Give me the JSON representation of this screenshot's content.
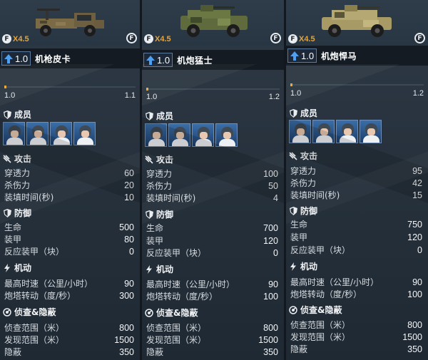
{
  "vehicles": [
    {
      "multiplier": "X4.5",
      "level": "1.0",
      "name": "机枪皮卡",
      "progress": {
        "min": "1.0",
        "max": "1.1",
        "fraction": 0.0
      },
      "crew_title": "成员",
      "attack_title": "攻击",
      "attack": [
        {
          "label": "穿透力",
          "value": "60"
        },
        {
          "label": "杀伤力",
          "value": "20"
        },
        {
          "label": "装填时间(秒)",
          "value": "10"
        }
      ],
      "defense_title": "防御",
      "defense": [
        {
          "label": "生命",
          "value": "500"
        },
        {
          "label": "装甲",
          "value": "80"
        },
        {
          "label": "反应装甲（块）",
          "value": "0"
        }
      ],
      "mobility_title": "机动",
      "mobility": [
        {
          "label": "最高时速（公里/小时）",
          "value": "90"
        },
        {
          "label": "炮塔转动（度/秒）",
          "value": "300"
        }
      ],
      "recon_title": "侦查&隐蔽",
      "recon": [
        {
          "label": "侦查范围（米）",
          "value": "800"
        },
        {
          "label": "发现范围（米）",
          "value": "1500"
        },
        {
          "label": "隐蔽",
          "value": "350"
        }
      ]
    },
    {
      "multiplier": "X4.5",
      "level": "1.0",
      "name": "机炮猛士",
      "progress": {
        "min": "1.0",
        "max": "1.2",
        "fraction": 0.0
      },
      "crew_title": "成员",
      "attack_title": "攻击",
      "attack": [
        {
          "label": "穿透力",
          "value": "100"
        },
        {
          "label": "杀伤力",
          "value": "50"
        },
        {
          "label": "装填时间(秒)",
          "value": "4"
        }
      ],
      "defense_title": "防御",
      "defense": [
        {
          "label": "生命",
          "value": "700"
        },
        {
          "label": "装甲",
          "value": "120"
        },
        {
          "label": "反应装甲（块）",
          "value": "0"
        }
      ],
      "mobility_title": "机动",
      "mobility": [
        {
          "label": "最高时速（公里/小时）",
          "value": "90"
        },
        {
          "label": "炮塔转动（度/秒）",
          "value": "100"
        }
      ],
      "recon_title": "侦查&隐蔽",
      "recon": [
        {
          "label": "侦查范围（米）",
          "value": "800"
        },
        {
          "label": "发现范围（米）",
          "value": "1500"
        },
        {
          "label": "隐蔽",
          "value": "350"
        }
      ]
    },
    {
      "multiplier": "X4.5",
      "level": "1.0",
      "name": "机炮悍马",
      "progress": {
        "min": "1.0",
        "max": "1.2",
        "fraction": 0.0
      },
      "crew_title": "成员",
      "attack_title": "攻击",
      "attack": [
        {
          "label": "穿透力",
          "value": "95"
        },
        {
          "label": "杀伤力",
          "value": "42"
        },
        {
          "label": "装填时间(秒)",
          "value": "15"
        }
      ],
      "defense_title": "防御",
      "defense": [
        {
          "label": "生命",
          "value": "750"
        },
        {
          "label": "装甲",
          "value": "120"
        },
        {
          "label": "反应装甲（块）",
          "value": "0"
        }
      ],
      "mobility_title": "机动",
      "mobility": [
        {
          "label": "最高时速（公里/小时）",
          "value": "90"
        },
        {
          "label": "炮塔转动（度/秒）",
          "value": "100"
        }
      ],
      "recon_title": "侦查&隐蔽",
      "recon": [
        {
          "label": "侦查范围（米）",
          "value": "800"
        },
        {
          "label": "发现范围（米）",
          "value": "1500"
        },
        {
          "label": "隐蔽",
          "value": "350"
        }
      ]
    }
  ],
  "colors": {
    "accent": "#e4a93a",
    "level_border": "#5b7aa0",
    "background": "#1a2430"
  },
  "icons": {
    "currency": "f-coin-icon",
    "level": "up-arrow-icon",
    "crew": "shield-icon",
    "attack": "crossed-bullets-icon",
    "defense": "shield-icon",
    "mobility": "lightning-icon",
    "recon": "radar-icon"
  }
}
